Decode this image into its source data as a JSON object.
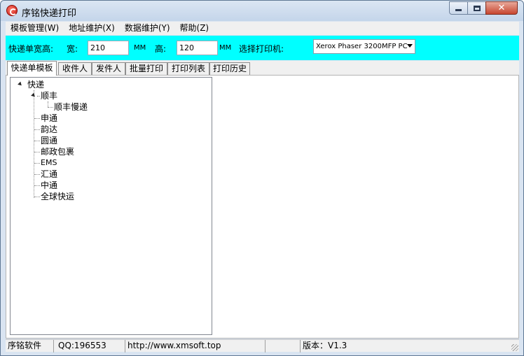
{
  "window": {
    "title": "序铭快递打印"
  },
  "menu": [
    {
      "label": "模板管理(W)"
    },
    {
      "label": "地址维护(X)"
    },
    {
      "label": "数据维护(Y)"
    },
    {
      "label": "帮助(Z)"
    }
  ],
  "dims": {
    "size_label": "快递单宽高:",
    "width_label": "宽:",
    "width_value": "210",
    "width_unit": "MM",
    "height_label": "高:",
    "height_value": "120",
    "height_unit": "MM",
    "printer_label": "选择打印机:",
    "printer_value": "Xerox Phaser 3200MFP PC"
  },
  "tabs": [
    {
      "label": "快递单模板",
      "active": true
    },
    {
      "label": "收件人"
    },
    {
      "label": "发件人"
    },
    {
      "label": "批量打印"
    },
    {
      "label": "打印列表"
    },
    {
      "label": "打印历史"
    }
  ],
  "tree": {
    "root": "快递",
    "sf": "顺丰",
    "sf_child": "顺丰慢递",
    "items": [
      "申通",
      "韵达",
      "圆通",
      "邮政包裹",
      "EMS",
      "汇通",
      "中通",
      "全球快运"
    ]
  },
  "status": {
    "company": "序铭软件",
    "qq": "QQ:196553",
    "url": "http://www.xmsoft.top",
    "version": "版本：V1.3"
  },
  "colors": {
    "dimbar_bg": "#00ffff",
    "close_button": "#c7452f"
  }
}
